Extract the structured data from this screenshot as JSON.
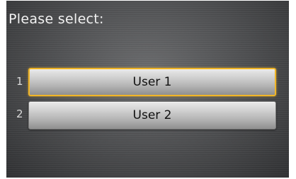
{
  "prompt": {
    "title": "Please select:"
  },
  "options": [
    {
      "index": "1",
      "label": "User 1",
      "selected": true
    },
    {
      "index": "2",
      "label": "User 2",
      "selected": false
    }
  ],
  "colors": {
    "highlight": "#f0b528",
    "background": "#4b4c4e",
    "text": "#f2f2f2"
  }
}
